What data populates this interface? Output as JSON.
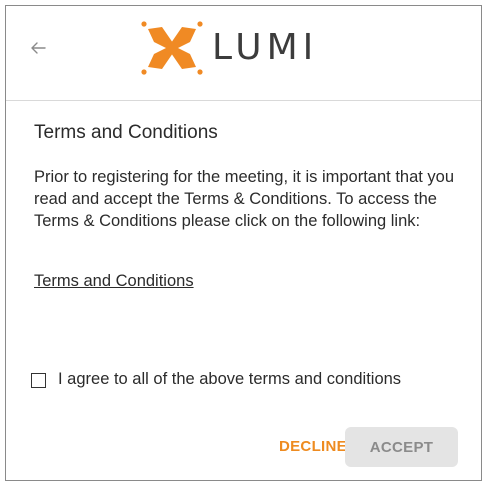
{
  "header": {
    "back_icon": "arrow-left-icon",
    "logo_text": "LUMI",
    "logo_color": "#f08a24"
  },
  "content": {
    "title": "Terms and Conditions",
    "body": "Prior to registering for the meeting, it is important that you read and accept the Terms & Conditions. To access the Terms & Conditions please click on the following link:",
    "link_label": "Terms and Conditions"
  },
  "agreement": {
    "checked": false,
    "label": "I agree to all of the above terms and conditions"
  },
  "actions": {
    "decline_label": "DECLINE",
    "accept_label": "ACCEPT",
    "decline_color": "#ee8b20",
    "accept_bg": "#e4e4e4"
  }
}
